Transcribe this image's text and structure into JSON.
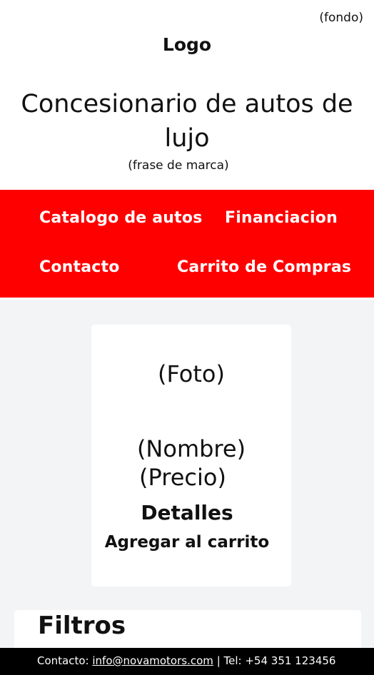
{
  "header": {
    "fondo_label": "(fondo)",
    "logo": "Logo",
    "title": "Concesionario de autos de lujo",
    "tagline": "(frase de marca)"
  },
  "nav": {
    "items": [
      {
        "label": "Catalogo de autos"
      },
      {
        "label": "Financiacion"
      },
      {
        "label": "Contacto"
      },
      {
        "label": "Carrito de Compras"
      }
    ],
    "background": "#ff0000"
  },
  "product_card": {
    "photo_placeholder": "(Foto)",
    "name_placeholder": "(Nombre)",
    "price_placeholder": "(Precio)",
    "details_label": "Detalles",
    "add_to_cart_label": "Agregar al carrito"
  },
  "filters": {
    "title": "Filtros"
  },
  "footer": {
    "contact_prefix": "Contacto:",
    "email": "info@novamotors.com",
    "separator": "|",
    "phone_text": "Tel: +54 351 123456",
    "background": "#000000"
  }
}
